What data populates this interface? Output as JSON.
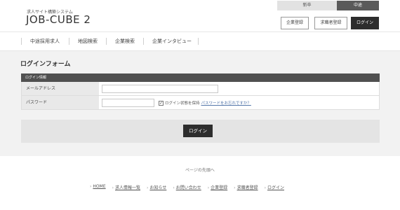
{
  "header": {
    "tagline": "求人サイト構築システム",
    "logo": "JOB-CUBE 2",
    "top_tabs": [
      {
        "label": "新卒"
      },
      {
        "label": "中途"
      }
    ],
    "buttons": {
      "company_register": "企業登録",
      "seeker_register": "求職者登録",
      "login": "ログイン"
    }
  },
  "nav": {
    "items": [
      "中途採用求人",
      "地図検索",
      "企業検索",
      "企業インタビュー"
    ]
  },
  "form": {
    "title": "ログインフォーム",
    "section_header": "ログイン情報",
    "email_label": "メールアドレス",
    "email_value": "",
    "password_label": "パスワード",
    "password_value": "",
    "keep_login_label": "ログイン状態を保持",
    "keep_login_checked": true,
    "forgot_password": "パスワードをお忘れですか？",
    "submit_label": "ログイン"
  },
  "footer": {
    "back_to_top": "ページの先頭へ",
    "links": [
      "HOME",
      "求人情報一覧",
      "お知らせ",
      "お問い合わせ",
      "企業登録",
      "求職者登録",
      "ログイン"
    ]
  }
}
